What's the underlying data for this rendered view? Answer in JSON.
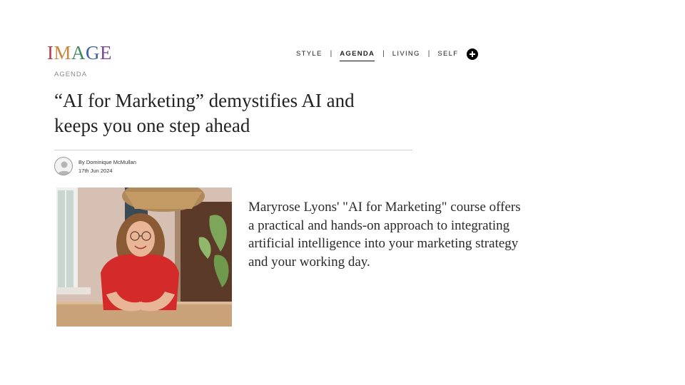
{
  "brand": {
    "logo_letters": [
      "I",
      "M",
      "A",
      "G",
      "E"
    ],
    "logo_colors": [
      "#b83a4b",
      "#c9873a",
      "#3d8a5f",
      "#3a5fa8",
      "#7a4aa0"
    ]
  },
  "nav": {
    "items": [
      {
        "label": "STYLE",
        "active": false
      },
      {
        "label": "AGENDA",
        "active": true
      },
      {
        "label": "LIVING",
        "active": false
      },
      {
        "label": "SELF",
        "active": false
      }
    ],
    "separator": "|",
    "more_icon": "plus-circle-icon"
  },
  "article": {
    "category": "AGENDA",
    "headline": "“AI for Marketing” demystifies AI and keeps you one step ahead",
    "author": "By Dominique McMullan",
    "date": "17th Jun 2024",
    "intro": "Maryrose Lyons' \"AI for Marketing\" course offers a practical and hands-on approach to integrating artificial intelligence into your marketing strategy and your working day."
  },
  "colors": {
    "text": "#222222",
    "muted": "#8a8a8a",
    "divider": "#cfcfcf",
    "plus_button": "#000000"
  }
}
